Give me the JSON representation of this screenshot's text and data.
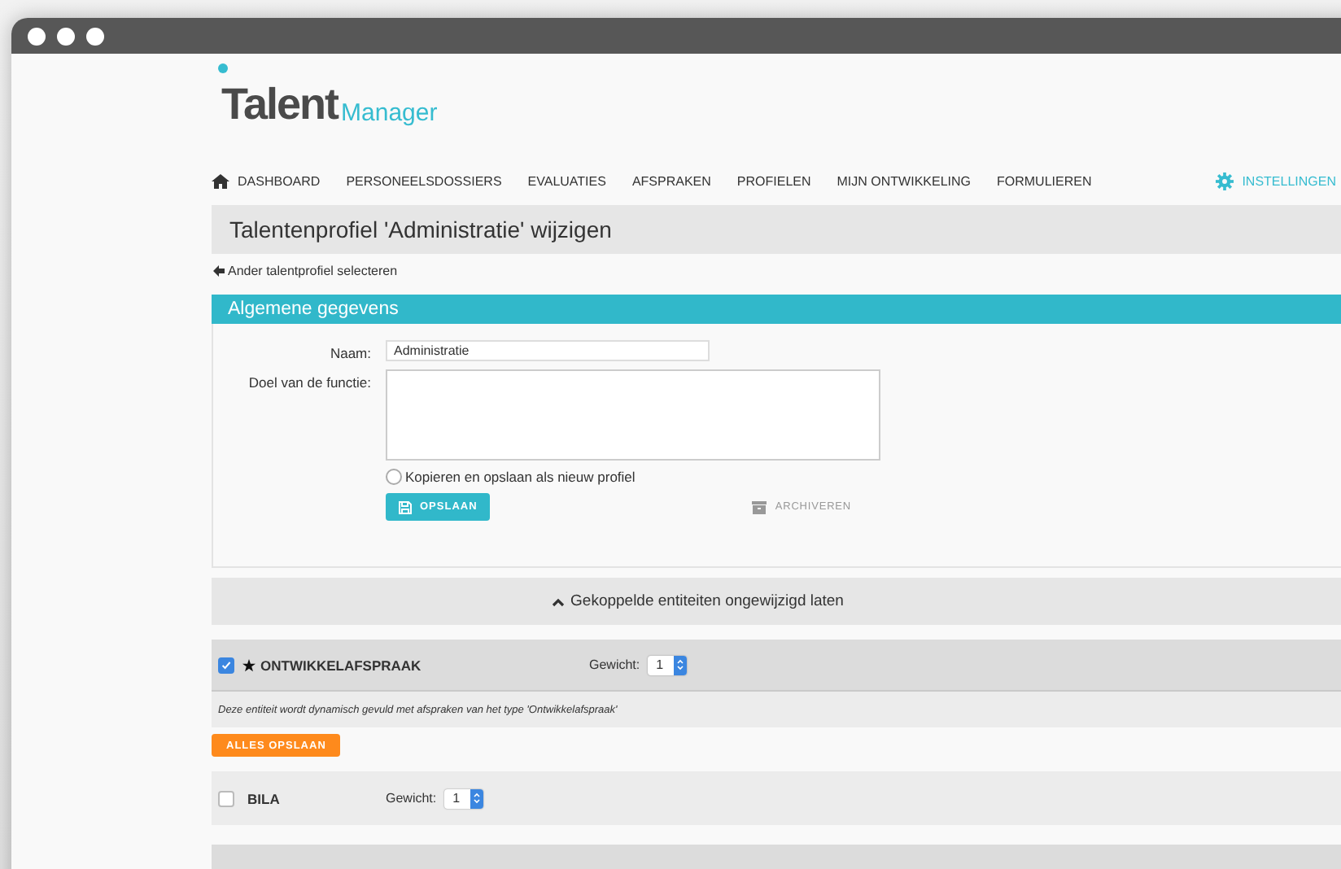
{
  "logo": {
    "bold": "Talent",
    "light": "Manager"
  },
  "nav": {
    "items": [
      {
        "label": "DASHBOARD"
      },
      {
        "label": "PERSONEELSDOSSIERS"
      },
      {
        "label": "EVALUATIES"
      },
      {
        "label": "AFSPRAKEN"
      },
      {
        "label": "PROFIELEN"
      },
      {
        "label": "MIJN ONTWIKKELING"
      },
      {
        "label": "FORMULIEREN"
      }
    ],
    "settings": "INSTELLINGEN"
  },
  "page_title": "Talentenprofiel 'Administratie' wijzigen",
  "back_link": "Ander talentprofiel selecteren",
  "section": {
    "title": "Algemene gegevens",
    "name_label": "Naam:",
    "name_value": "Administratie",
    "goal_label": "Doel van de functie:",
    "copy_option": {
      "label": "Kopieren en opslaan als nieuw profiel",
      "checked": false
    },
    "save_button": "OPSLAAN",
    "archive_button": "ARCHIVEREN"
  },
  "collapse_bar": {
    "label": "Gekoppelde entiteiten ongewijzigd laten",
    "expanded": true
  },
  "entities": [
    {
      "name": "ONTWIKKELAFSPRAAK",
      "checked": true,
      "starred": true,
      "weight_label": "Gewicht:",
      "weight": "1",
      "description": "Deze entiteit wordt dynamisch gevuld met afspraken van het type 'Ontwikkelafspraak'",
      "action": "ALLES OPSLAAN"
    },
    {
      "name": "BILA",
      "checked": false,
      "starred": false,
      "weight_label": "Gewicht:",
      "weight": "1"
    }
  ]
}
